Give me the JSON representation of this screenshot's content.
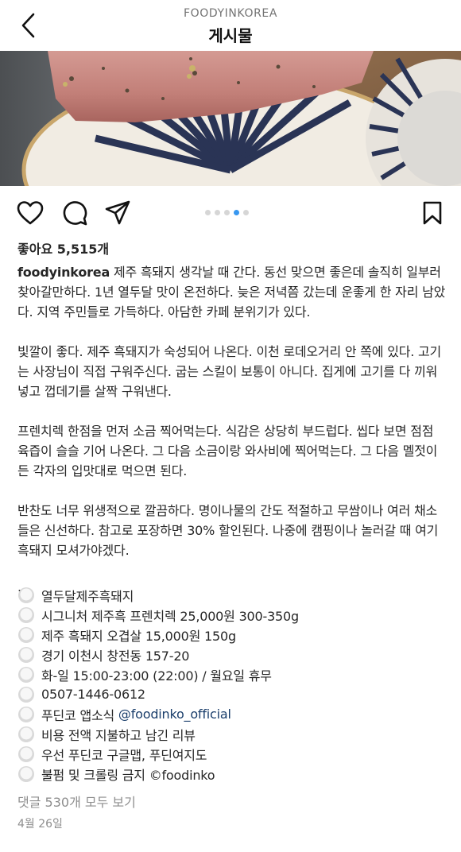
{
  "header": {
    "account": "FOODYINKOREA",
    "title": "게시물"
  },
  "post": {
    "likes": "좋아요 5,515개",
    "username": "foodyinkorea",
    "paragraphs": [
      "제주 흑돼지 생각날 때 간다. 동선 맞으면 좋은데 솔직히 일부러 찾아갈만하다. 1년 열두달 맛이 온전하다. 늦은 저녁쯤 갔는데 운좋게 한 자리 남았다. 지역 주민들로 가득하다. 아담한 카페 분위기가 있다.",
      "빛깔이 좋다. 제주 흑돼지가 숙성되어 나온다. 이천 로데오거리 안 쪽에 있다. 고기는 사장님이 직접 구워주신다. 굽는 스킬이 보통이 아니다. 집게에 고기를 다 끼워넣고 껍데기를 살짝 구워낸다.",
      "프렌치렉 한점을 먼저 소금 찍어먹는다. 식감은 상당히 부드럽다. 씹다 보면 점점 육즙이 슬슬 기어 나온다. 그 다음 소금이랑 와사비에 찍어먹는다. 그 다음 멜젓이든 각자의 입맛대로 먹으면 된다.",
      "반찬도 너무 위생적으로 깔끔하다. 명이나물의 간도 적절하고 무쌈이나 여러 채소들은 신선하다. 참고로 포장하면 30% 할인된다. 나중에 캠핑이나 놀러갈 때 여기 흑돼지 모셔가야겠다."
    ],
    "separator": ".",
    "info": [
      "열두달제주흑돼지",
      "시그니처 제주흑 프렌치렉 25,000원 300-350g",
      "제주 흑돼지 오겹살 15,000원 150g",
      "경기 이천시 창전동 157-20",
      "화-일 15:00-23:00 (22:00) / 월요일 휴무",
      "0507-1446-0612"
    ],
    "official_prefix": "푸딘코 앱소식 ",
    "official_handle": "@foodinko_official",
    "info_tail": [
      "비용 전액 지불하고 남긴 리뷰",
      "우선 푸딘코 구글맵, 푸딘여지도",
      "불펌 및 크롤링 금지 ©foodinko"
    ],
    "comments": "댓글 530개 모두 보기",
    "date": "4월 26일"
  },
  "carousel": {
    "count": 5,
    "active_index": 3
  },
  "icons": {
    "back": "chevron-left-icon",
    "like": "heart-icon",
    "comment": "comment-bubble-icon",
    "share": "paper-plane-icon",
    "save": "bookmark-icon",
    "bullet": "white-circle-emoji-icon"
  },
  "colors": {
    "text": "#262626",
    "muted": "#8e8e8e",
    "carousel_active": "#3897f0",
    "mention": "#1a3e6b"
  }
}
